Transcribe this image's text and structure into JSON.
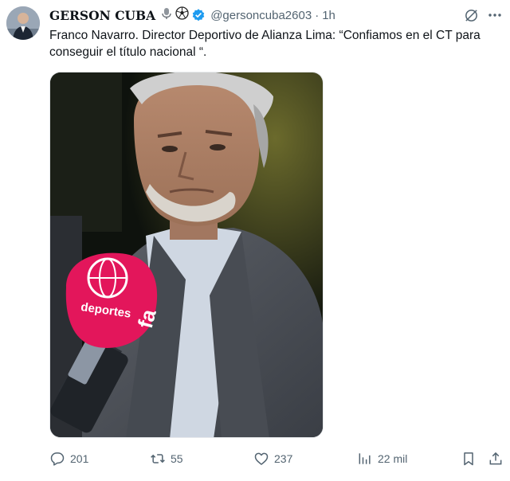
{
  "author": {
    "name": "GERSON CUBA",
    "handle": "@gersoncuba2603",
    "separator": "·",
    "time": "1h",
    "name_emojis": [
      "microphone-icon",
      "soccer-ball-icon"
    ],
    "verified_badge": "verified-icon"
  },
  "tweet": {
    "text": "Franco Navarro. Director Deportivo de Alianza Lima: “Confiamos en el CT para conseguir el título nacional “."
  },
  "media": {
    "type": "video-still",
    "microphone_labels": [
      "deportes",
      "fa"
    ]
  },
  "actions": {
    "replies": "201",
    "reposts": "55",
    "likes": "237",
    "views": "22 mil"
  },
  "colors": {
    "text": "#0f1419",
    "secondary": "#536471",
    "verified": "#1d9bf0",
    "mic_pink": "#e3165b"
  }
}
